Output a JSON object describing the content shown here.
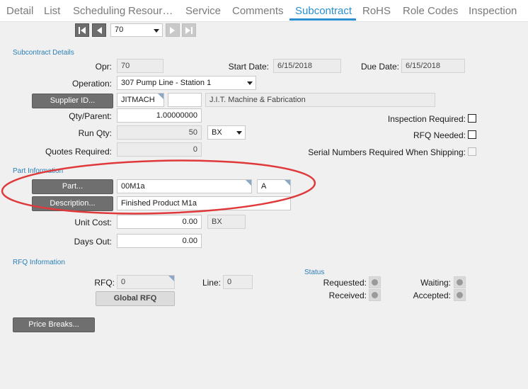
{
  "tabs": [
    "Detail",
    "List",
    "Scheduling",
    "Resour…",
    "Service",
    "Comments",
    "Subcontract",
    "RoHS",
    "Role Codes",
    "Inspection"
  ],
  "active_tab": "Subcontract",
  "nav": {
    "record_value": "70"
  },
  "sections": {
    "subcontract": "Subcontract Details",
    "part": "Part Information",
    "rfq": "RFQ Information",
    "status": "Status"
  },
  "subcontract": {
    "opr_label": "Opr:",
    "opr_value": "70",
    "start_label": "Start Date:",
    "start_value": "6/15/2018",
    "due_label": "Due Date:",
    "due_value": "6/15/2018",
    "operation_label": "Operation:",
    "operation_value": "307 Pump Line - Station 1",
    "supplier_button": "Supplier ID...",
    "supplier_id": "JITMACH",
    "supplier_extra": "",
    "supplier_name": "J.I.T. Machine & Fabrication",
    "qty_parent_label": "Qty/Parent:",
    "qty_parent_value": "1.00000000",
    "run_qty_label": "Run Qty:",
    "run_qty_value": "50",
    "run_qty_uom": "BX",
    "quotes_label": "Quotes Required:",
    "quotes_value": "0",
    "inspection_label": "Inspection Required:",
    "rfq_needed_label": "RFQ Needed:",
    "serial_label": "Serial Numbers Required When Shipping:"
  },
  "part": {
    "part_button": "Part...",
    "part_value": "00M1a",
    "rev_value": "A",
    "desc_button": "Description...",
    "desc_value": "Finished Product M1a",
    "unit_cost_label": "Unit Cost:",
    "unit_cost_value": "0.00",
    "unit_cost_uom": "BX",
    "days_out_label": "Days Out:",
    "days_out_value": "0.00"
  },
  "rfq": {
    "rfq_label": "RFQ:",
    "rfq_value": "0",
    "line_label": "Line:",
    "line_value": "0",
    "global_button": "Global RFQ"
  },
  "status": {
    "requested": "Requested:",
    "received": "Received:",
    "waiting": "Waiting:",
    "accepted": "Accepted:"
  },
  "price_breaks_button": "Price Breaks...",
  "annotation_color": "#e0393b"
}
